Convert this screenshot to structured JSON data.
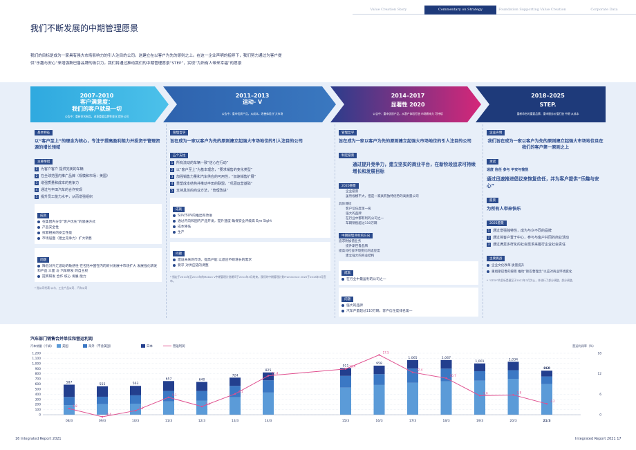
{
  "nav": {
    "tabs": [
      "Value Creation Story",
      "Commentary on Strategy",
      "Foundation Supporting Value Creation",
      "Corporate Data"
    ],
    "active": 1
  },
  "title": "我们不断发展的中期管理愿景",
  "intro": "我们的目标是成为一家具有强大市场影响力的引人注目的公司。这建立在以客户为先的原则之上。在这一企业声明的指导下，我们努力通过为客户提供“乐趣与安心”来增强斯巴鲁品牌的吸引力。我们将通过推动我们的中期管理愿景“STEP”，实现“为所有人带来幸福”的愿景",
  "phases": [
    {
      "years": "2007–2010",
      "name": "客户满意度：\n我们的客户就是一切",
      "sub": "公告中：重新命名制品，改革重要品牌性变化 提升公司"
    },
    {
      "years": "2011–2013",
      "name": "运动- V",
      "sub": "公告中：重申优质产品，从成本，改善体验 扩大市场"
    },
    {
      "years": "2014–2017",
      "name": "显著性 2020",
      "sub": "公告中：重申优质产品，从客户体验打造 市场影响力 可持续"
    },
    {
      "years": "2018–2025",
      "name": "STEP.",
      "sub": "重新命名的重要品牌，重申服务价值打造 中期 从成本"
    }
  ],
  "col1": {
    "tag1": "基本特征",
    "big": "以“客户至上”的理念为核心，专注于提高盈利能力并投资于管理资源的增长领域",
    "tag2": "主要举措",
    "items": [
      "为客户客户 提供完美的车辆",
      "在全球范围内推广品牌（规模和市场：美国）",
      "增强质量和成本的竞争力",
      "通过与丰田汽车的合作实现",
      "提升员工能力水平，从而增强组织"
    ],
    "box1_tag": "成就",
    "box1_items": [
      "在集团内分享“客户优先”的思维方式",
      "产品安全性",
      "拆卸相关的安全性能",
      "市场层面（建立竞争力）扩大销售"
    ],
    "box2_tag": "问题",
    "box2_items": [
      "降低对外汇波动的敏感性 在包括中国在内的新兴发展中市场扩大 发展强化研发 和产品 三面 与 汽车研发 的自主权",
      "提高研发 合作 核心 发展 能力"
    ],
    "note": "* 指公司代表 以与、工业产品公司、汽车公司"
  },
  "col2": {
    "tag1": "管理哲学",
    "big": "旨在成为一家以客户为先的原则建立起强大市场地位的引人注目的公司",
    "tag2": "五个支柱",
    "items": [
      "所有流动的车辆一致“信心在行动”",
      "以“客户至上”为基本理念，“要求销售的变化类型”",
      "加强销售力量和汽车供应的可用性，“加速销售扩展”",
      "重塑成本结构并推动丰田的联盟，“巩固运营基础”",
      "支持具体的商业方法，“管理改进”"
    ],
    "box1_tag": "成就",
    "box1_items": [
      "SUV/SUV的推出和改进",
      "通过内向和国内产品开发，提升速度 确保安全评级高 Eye Sight",
      "成本降低",
      "生产"
    ],
    "box2_tag": "问题",
    "box2_items": [
      "建设未来的市场，提高产能 以适应不断增长的需求",
      "要求 对供应链的调整"
    ],
    "note": "* 指定于2011年至2013年的Motion V中期管理计划期间于2014年3月结束。我们的中期管理计划Prominence 2020于2018年3月宣布。"
  },
  "col3": {
    "tag1": "管理哲学",
    "big": "旨在成为一家以客户为先的原则建立起强大市场地位的引人注目的公司",
    "tag2": "制定愿景",
    "big2": "通过提升竞争力，建立坚实的商业平台，在新阶段追求可持续增长和发展目标",
    "tag3": "2020愿景",
    "t3_items": [
      "企业愿景",
      "虽然规模不大，但是一家具有独特优势的高质量公司"
    ],
    "t4": "具体目标",
    "t4_items": [
      "客户信任度第一名",
      "强大的品牌",
      "在行业中都有利的公司之一",
      "车辆销售超过110万辆"
    ],
    "tag5": "中期管理目标的方向",
    "t5_items": [
      "追求附加值业务",
      "提升斯巴鲁品牌",
      "提高对社会环境变化的适应度",
      "建立强大的商业结构"
    ],
    "box1_tag": "成就",
    "box1_items": [
      "在行业中最盈利的公司之一"
    ],
    "box2_tag": "问题",
    "box2_items": [
      "强大的品牌",
      "汽车产量超过110万辆，客户信任度排名第一"
    ]
  },
  "col4": {
    "tag1": "企业声明",
    "big": "我们旨在成为一家以客户为先的原则建立起强大市场地位且在我们的客户第一原则之上",
    "tag2": "承诺",
    "t2": "速度 信任 参与 平安与愉悦",
    "big2": "通过迅速推进倡议来恢复信任，并为客户提供“乐趣与安心”",
    "tag3": "愿景",
    "t3": "为所有人带来快乐",
    "tag4": "2025愿景",
    "items": [
      "通过增强独特性，成为与众不同的品牌",
      "通过将客户置于中心，参与与客户共同的商业活动",
      "通过满足多样化的社会需求来履行企业社会责任"
    ],
    "tag5": "主要挑战",
    "t5_items": [
      "企业文化改革 质量提升",
      "重组斯巴鲁的愿景 推动“斯巴鲁理念”以应对商业环境变化"
    ],
    "note": "* “STEP”的目标是截至于2022年3月为止，并进行了部分调整。部分调整。"
  },
  "chart": {
    "title": "汽车部门销售合并单位和营运利润",
    "unit_left": "汽车销量（千辆）",
    "unit_right": "营运利润率（%）",
    "legend": {
      "a": "美国",
      "b": "海外（不含美国）",
      "c": "日本",
      "d": "营运利润"
    },
    "years": [
      "08/3",
      "09/3",
      "10/3",
      "11/3",
      "12/3",
      "13/3",
      "14/3",
      "15/3",
      "16/3",
      "17/3",
      "18/3",
      "19/3",
      "20/3",
      "21/3"
    ],
    "totals": [
      "587",
      "555",
      "563",
      "657",
      "640",
      "724",
      "825",
      "911",
      "958",
      "1,065",
      "1,067",
      "1,001",
      "1,034",
      "860"
    ],
    "yticks_left": [
      "1,200",
      "1,100",
      "1,000",
      "900",
      "800",
      "700",
      "600",
      "500",
      "400",
      "300",
      "200",
      "100",
      "0"
    ],
    "yticks_right": [
      "18",
      "12",
      "6",
      "0"
    ]
  },
  "chart_data": {
    "type": "bar",
    "title": "汽车部门销售合并单位和营运利润",
    "xlabel": "",
    "ylabel": "汽车销量（千辆）",
    "ylim": [
      0,
      1200
    ],
    "y2label": "营运利润率（%）",
    "y2lim": [
      0,
      18
    ],
    "categories": [
      "08/3",
      "09/3",
      "10/3",
      "11/3",
      "12/3",
      "13/3",
      "14/3",
      "15/3",
      "16/3",
      "17/3",
      "18/3",
      "19/3",
      "20/3",
      "21/3"
    ],
    "series": [
      {
        "name": "美国",
        "type": "bar",
        "stack": "a",
        "values": [
          187,
          206,
          216,
          259,
          272,
          341,
          433,
          530,
          581,
          623,
          653,
          664,
          701,
          597
        ]
      },
      {
        "name": "海外（不含美国）",
        "type": "bar",
        "stack": "a",
        "values": [
          160,
          145,
          163,
          204,
          191,
          222,
          239,
          228,
          211,
          279,
          247,
          186,
          168,
          150
        ]
      },
      {
        "name": "日本",
        "type": "bar",
        "stack": "a",
        "values": [
          240,
          204,
          184,
          194,
          177,
          161,
          153,
          153,
          166,
          163,
          167,
          151,
          165,
          113
        ]
      },
      {
        "name": "营运利润",
        "type": "line",
        "axis": "right",
        "values": [
          1.8,
          -0.6,
          1.2,
          5.1,
          2.4,
          6.1,
          11.4,
          13.4,
          17.5,
          12.4,
          10.7,
          5.6,
          5.8,
          3.2
        ]
      }
    ],
    "line_labels": [
      "1.8",
      "-0.6",
      "1.2",
      "5.1",
      "2.4",
      "6.1",
      "11.4",
      "13.4",
      "17.5",
      "12.4",
      "10.7",
      "5.6",
      "5.8",
      "3.2"
    ]
  },
  "footer": {
    "left": "16  Integrated Report 2021",
    "right": "Integrated Report 2021  17"
  },
  "colors": {
    "navy": "#1e3a7a",
    "blue": "#2a4a8c",
    "cyan": "#2aa8e0",
    "pink": "#d8287a",
    "barA": "#5b9bd8",
    "barB": "#3b78c4",
    "barC": "#233f8e",
    "line": "#e0508f"
  }
}
